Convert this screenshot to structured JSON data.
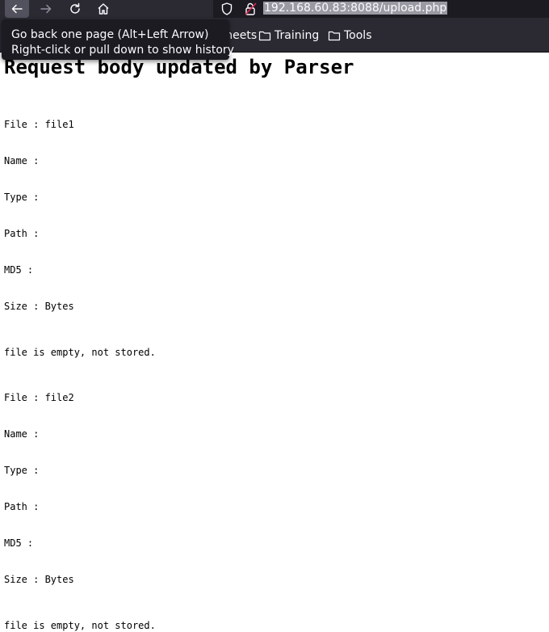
{
  "browser": {
    "url_text": "192.168.60.83:8088/upload.php",
    "bookmarks": {
      "partial_label": "heat sheets",
      "items": [
        {
          "label": "Training"
        },
        {
          "label": "Tools"
        }
      ]
    },
    "tooltip": {
      "line1": "Go back one page (Alt+Left Arrow)",
      "line2": "Right-click or pull down to show history"
    }
  },
  "page": {
    "heading": "Request body updated by Parser",
    "files": [
      {
        "file_label": "File : file1",
        "name_label": "Name :",
        "type_label": "Type :",
        "path_label": "Path :",
        "md5_label": "MD5 :",
        "size_label": "Size : Bytes",
        "status": "file is empty, not stored."
      },
      {
        "file_label": "File : file2",
        "name_label": "Name :",
        "type_label": "Type :",
        "path_label": "Path :",
        "md5_label": "MD5 :",
        "size_label": "Size : Bytes",
        "status": "file is empty, not stored."
      }
    ]
  }
}
